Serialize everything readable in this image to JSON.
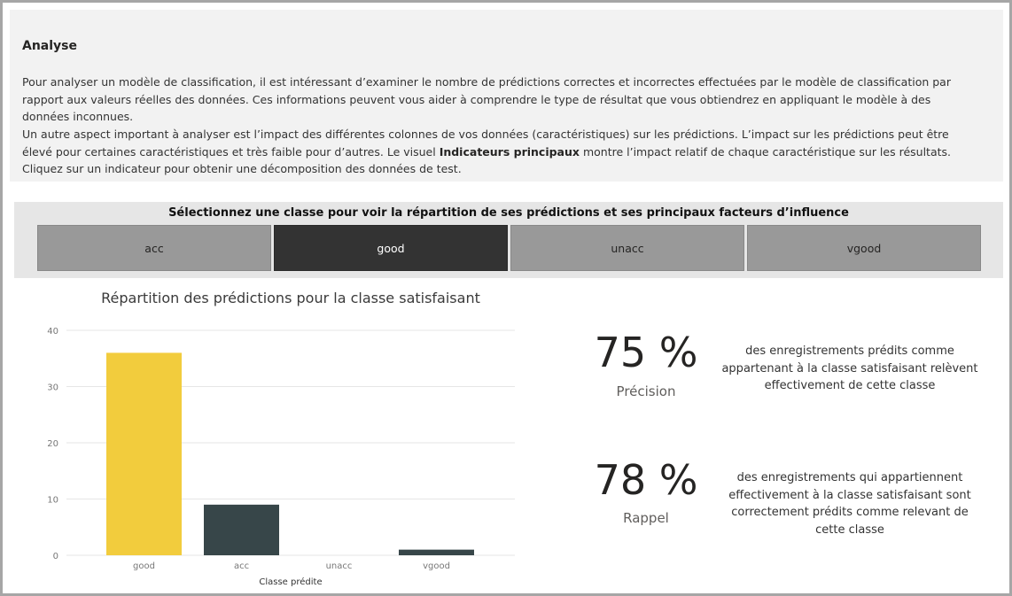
{
  "intro": {
    "heading": "Analyse",
    "paragraph1": "Pour analyser un modèle de classification, il est intéressant d’examiner le nombre de prédictions correctes et incorrectes effectuées par le modèle de classification par rapport aux valeurs réelles des données. Ces informations peuvent vous aider à comprendre le type de résultat que vous obtiendrez en appliquant le modèle à des données inconnues.",
    "paragraph2_before": "Un autre aspect important à analyser est l’impact des différentes colonnes de vos données (caractéristiques) sur les prédictions. L’impact sur les prédictions peut être élevé pour certaines caractéristiques et très faible pour d’autres. Le visuel ",
    "paragraph2_bold": "Indicateurs principaux",
    "paragraph2_after": " montre l’impact relatif de chaque caractéristique sur les résultats. Cliquez sur un indicateur pour obtenir une décomposition des données de test."
  },
  "selector": {
    "title": "Sélectionnez une classe pour voir la répartition de ses prédictions et ses principaux facteurs d’influence",
    "classes": [
      "acc",
      "good",
      "unacc",
      "vgood"
    ],
    "selected": "good"
  },
  "chart_data": {
    "type": "bar",
    "title": "Répartition des prédictions pour la classe satisfaisant",
    "xlabel": "Classe prédite",
    "ylabel": "",
    "categories": [
      "good",
      "acc",
      "unacc",
      "vgood"
    ],
    "values": [
      36,
      9,
      0,
      1
    ],
    "colors": [
      "#f2cc3d",
      "#374649",
      "#374649",
      "#374649"
    ],
    "ylim": [
      0,
      40
    ],
    "yticks": [
      0,
      10,
      20,
      30,
      40
    ],
    "grid": true
  },
  "metrics": {
    "precision": {
      "value": "75 %",
      "label": "Précision",
      "description": "des enregistrements prédits comme appartenant à la classe satisfaisant relèvent effectivement de cette classe"
    },
    "recall": {
      "value": "78 %",
      "label": "Rappel",
      "description": "des enregistrements qui appartiennent effectivement à la classe satisfaisant sont correctement prédits comme relevant de cette classe"
    }
  }
}
